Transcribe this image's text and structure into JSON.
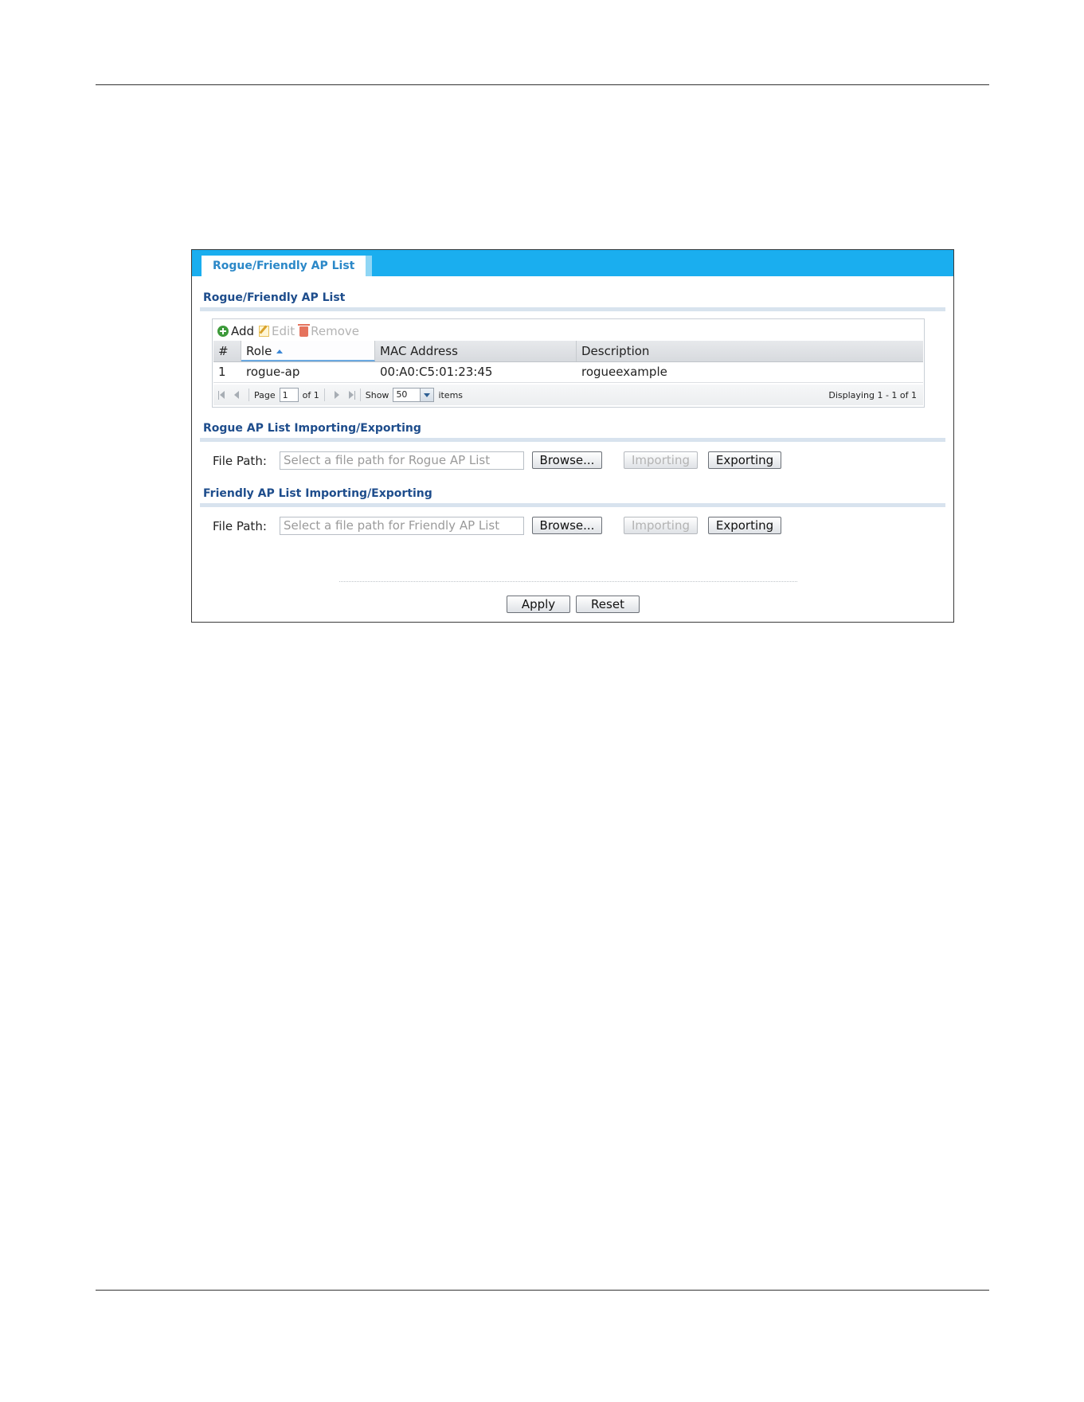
{
  "tab": {
    "label": "Rogue/Friendly AP List"
  },
  "list_section": {
    "title": "Rogue/Friendly AP List",
    "toolbar": {
      "add": "Add",
      "edit": "Edit",
      "remove": "Remove"
    },
    "columns": [
      "#",
      "Role",
      "MAC Address",
      "Description"
    ],
    "rows": [
      {
        "index": "1",
        "role": "rogue-ap",
        "mac": "00:A0:C5:01:23:45",
        "description": "rogueexample"
      }
    ],
    "pager": {
      "page_label": "Page",
      "page_value": "1",
      "of_label": "of 1",
      "show_label": "Show",
      "show_value": "50",
      "items_label": "items",
      "displaying": "Displaying 1 - 1 of 1"
    }
  },
  "rogue_section": {
    "title": "Rogue AP List Importing/Exporting",
    "file_path_label": "File Path:",
    "placeholder": "Select a file path for Rogue AP List",
    "browse": "Browse...",
    "importing": "Importing",
    "exporting": "Exporting"
  },
  "friendly_section": {
    "title": "Friendly AP List Importing/Exporting",
    "file_path_label": "File Path:",
    "placeholder": "Select a file path for Friendly AP List",
    "browse": "Browse...",
    "importing": "Importing",
    "exporting": "Exporting"
  },
  "footer": {
    "apply": "Apply",
    "reset": "Reset"
  },
  "colors": {
    "tabbar": "#1aaeef",
    "section_title": "#1e4d8c",
    "tab_text": "#2b88c8"
  },
  "icons": {
    "add": "add-circle-icon",
    "edit": "edit-icon",
    "remove": "trash-icon"
  }
}
